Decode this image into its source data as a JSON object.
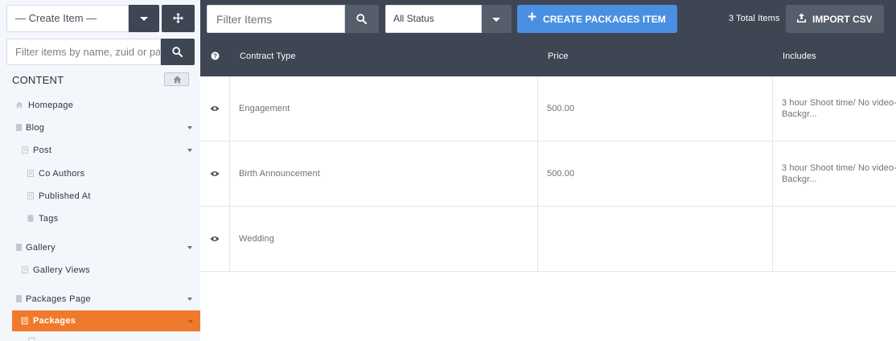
{
  "sidebar": {
    "create_item": "— Create Item —",
    "filter_placeholder": "Filter items by name, zuid or path",
    "content_label": "CONTENT",
    "items": [
      {
        "label": "Homepage"
      },
      {
        "label": "Blog"
      },
      {
        "label": "Post"
      },
      {
        "label": "Co Authors"
      },
      {
        "label": "Published At"
      },
      {
        "label": "Tags"
      },
      {
        "label": "Gallery"
      },
      {
        "label": "Gallery Views"
      },
      {
        "label": "Packages Page"
      },
      {
        "label": "Packages"
      }
    ]
  },
  "toolbar": {
    "filter_placeholder": "Filter Items",
    "status_value": "All Status",
    "create_label": "CREATE PACKAGES ITEM",
    "total_items": "3 Total Items",
    "import_label": "IMPORT CSV"
  },
  "table": {
    "columns": [
      "Contract Type",
      "Price",
      "Includes"
    ],
    "rows": [
      {
        "contract_type": "Engagement",
        "price": "500.00",
        "includes": "3 hour Shoot time/ No video-Backgr..."
      },
      {
        "contract_type": "Birth Announcement",
        "price": "500.00",
        "includes": "3 hour Shoot time/ No video-Backgr..."
      },
      {
        "contract_type": "Wedding",
        "price": "",
        "includes": ""
      }
    ]
  },
  "colors": {
    "toolbar_bg": "#3e4654",
    "accent_blue": "#4a90e2",
    "active_orange": "#f07a2c",
    "sidebar_bg": "#f3f6fb"
  }
}
